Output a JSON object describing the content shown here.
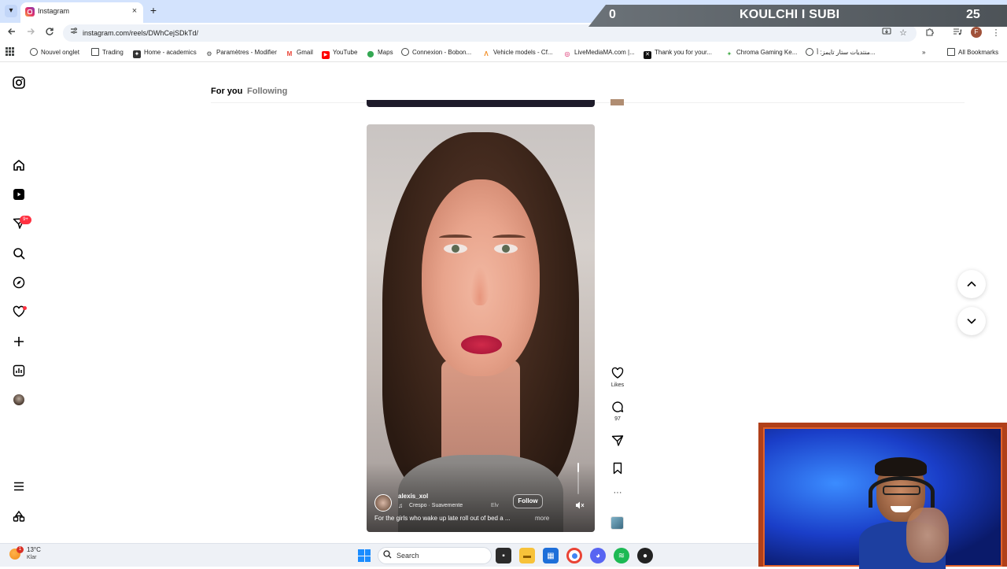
{
  "browser": {
    "tab_title": "Instagram",
    "tab_close": "×",
    "new_tab": "+",
    "minimize": "—",
    "url": "instagram.com/reels/DWhCejSDkTd/",
    "profile_initial": "F",
    "bookmarks": [
      {
        "label": "Nouvel onglet",
        "icon": "globe-icon",
        "color": "#444746"
      },
      {
        "label": "Trading",
        "icon": "folder-icon",
        "color": "#444746"
      },
      {
        "label": "Home - academics",
        "icon": "site-icon",
        "color": "#333333"
      },
      {
        "label": "Paramètres - Modifier",
        "icon": "gear-icon",
        "color": "#444746"
      },
      {
        "label": "Gmail",
        "icon": "gmail-icon",
        "color": "#ea4335"
      },
      {
        "label": "YouTube",
        "icon": "youtube-icon",
        "color": "#ff0000"
      },
      {
        "label": "Maps",
        "icon": "maps-icon",
        "color": "#34a853"
      },
      {
        "label": "Connexion - Bobon...",
        "icon": "globe-icon",
        "color": "#444746"
      },
      {
        "label": "Vehicle models - Cf...",
        "icon": "site-icon",
        "color": "#f28b20"
      },
      {
        "label": "LiveMediaMA.com |...",
        "icon": "site-icon",
        "color": "#d81b60"
      },
      {
        "label": "Thank you for your...",
        "icon": "site-icon",
        "color": "#111111"
      },
      {
        "label": "Chroma Gaming Ke...",
        "icon": "site-icon",
        "color": "#4caf50"
      },
      {
        "label": "منتديات ستار تايمز: أ...",
        "icon": "globe-icon",
        "color": "#444746"
      }
    ],
    "all_bookmarks": "All Bookmarks"
  },
  "overlay": {
    "score_left": "0",
    "title": "KOULCHI I SUBI",
    "score_right": "25"
  },
  "instagram": {
    "notif_badge": "9+",
    "tabs": {
      "for_you": "For you",
      "following": "Following"
    },
    "reel": {
      "author": "alexis_xol",
      "music": "Crespo · Suavemente",
      "music_extra": "Elv",
      "follow": "Follow",
      "caption": "For the girls who wake up late roll out of bed a ...",
      "more": "more",
      "progress": 0.3
    },
    "actions": {
      "likes_label": "Likes",
      "comments_count": "97",
      "more": "···"
    }
  },
  "taskbar": {
    "temperature": "13°C",
    "weather": "Klar",
    "weather_badge": "1",
    "search_placeholder": "Search"
  },
  "colors": {
    "instagram_red": "#ff3040",
    "chrome_tabstrip": "#d3e3fd",
    "windows_blue": "#1a8cff"
  }
}
